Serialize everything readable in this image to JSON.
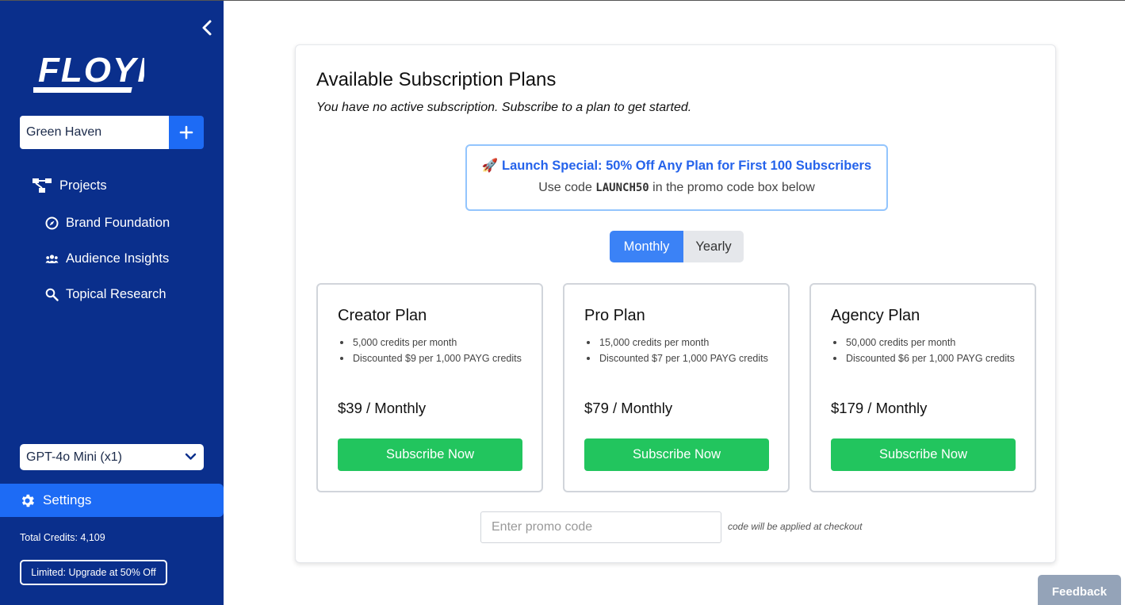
{
  "sidebar": {
    "logo_text": "FLOYI",
    "workspace": "Green Haven",
    "nav": {
      "projects": "Projects",
      "brand_foundation": "Brand Foundation",
      "audience_insights": "Audience Insights",
      "topical_research": "Topical Research"
    },
    "model": "GPT-4o Mini (x1)",
    "settings": "Settings",
    "credits": "Total Credits: 4,109",
    "upgrade": "Limited: Upgrade at 50% Off"
  },
  "main": {
    "title": "Available Subscription Plans",
    "subtitle": "You have no active subscription. Subscribe to a plan to get started.",
    "promo_banner": {
      "emoji": "🚀",
      "headline": "Launch Special: 50% Off Any Plan for First 100 Subscribers",
      "pre": "Use code ",
      "code": "LAUNCH50",
      "post": " in the promo code box below"
    },
    "billing_toggle": {
      "monthly": "Monthly",
      "yearly": "Yearly",
      "selected": "Monthly"
    },
    "plans": [
      {
        "name": "Creator Plan",
        "features": [
          "5,000 credits per month",
          "Discounted $9 per 1,000 PAYG credits"
        ],
        "price": "$39 / Monthly",
        "button": "Subscribe Now"
      },
      {
        "name": "Pro Plan",
        "features": [
          "15,000 credits per month",
          "Discounted $7 per 1,000 PAYG credits"
        ],
        "price": "$79 / Monthly",
        "button": "Subscribe Now"
      },
      {
        "name": "Agency Plan",
        "features": [
          "50,000 credits per month",
          "Discounted $6 per 1,000 PAYG credits"
        ],
        "price": "$179 / Monthly",
        "button": "Subscribe Now"
      }
    ],
    "promo_input_placeholder": "Enter promo code",
    "promo_note": "code will be applied at checkout"
  },
  "feedback": "Feedback",
  "colors": {
    "sidebar": "#0a2f8c",
    "accent": "#1d6bf5",
    "subscribe": "#22c55e",
    "toggle_active": "#3b82f6"
  }
}
